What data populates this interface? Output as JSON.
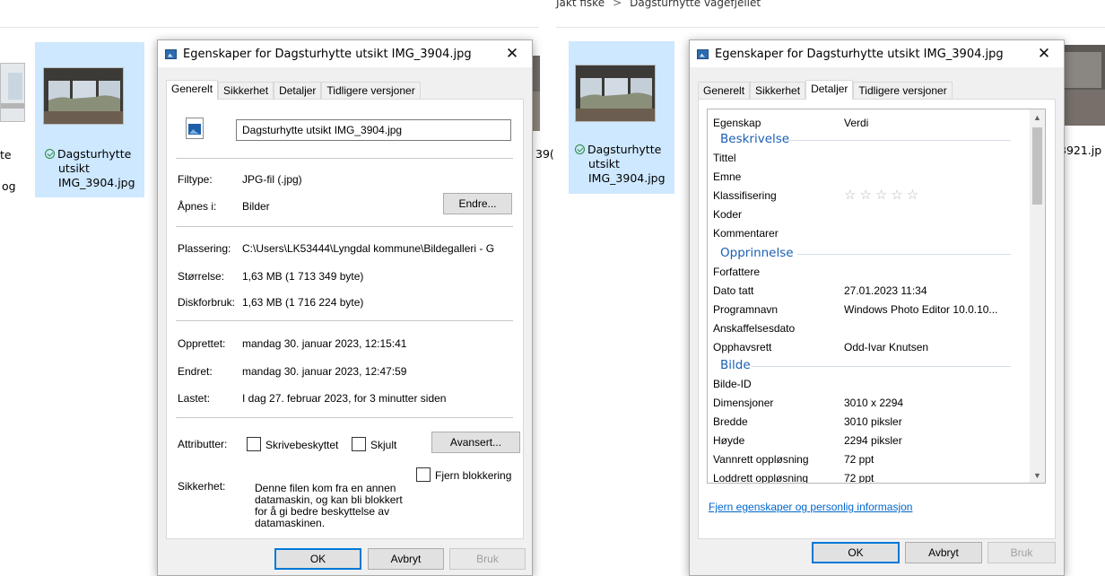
{
  "breadcrumb": {
    "part1": "Jakt fiske",
    "separator": ">",
    "part2": "Dagsturhytte vagefjellet"
  },
  "left_explorer": {
    "edge_left_lines": [
      "te",
      "og"
    ],
    "selected_item_lines": [
      "Dagsturhytte",
      "utsikt",
      "IMG_3904.jpg"
    ],
    "edge_right_text": "39("
  },
  "right_explorer": {
    "selected_item_lines": [
      "Dagsturhytte",
      "utsikt",
      "IMG_3904.jpg"
    ],
    "edge_right_text": "3921.jp"
  },
  "dialog_general": {
    "title": "Egenskaper for Dagsturhytte utsikt IMG_3904.jpg",
    "close": "✕",
    "tabs": [
      "Generelt",
      "Sikkerhet",
      "Detaljer",
      "Tidligere versjoner"
    ],
    "active_tab": "Generelt",
    "file_name": "Dagsturhytte utsikt IMG_3904.jpg",
    "filtype_label": "Filtype:",
    "filtype_value": "JPG-fil (.jpg)",
    "apnes_label": "Åpnes i:",
    "apnes_value": "Bilder",
    "change_button": "Endre...",
    "plassering_label": "Plassering:",
    "plassering_value": "C:\\Users\\LK53444\\Lyngdal kommune\\Bildegalleri - G",
    "storrelse_label": "Størrelse:",
    "storrelse_value": "1,63 MB (1 713 349 byte)",
    "disk_label": "Diskforbruk:",
    "disk_value": "1,63 MB (1 716 224 byte)",
    "opprettet_label": "Opprettet:",
    "opprettet_value": "mandag 30. januar 2023, 12:15:41",
    "endret_label": "Endret:",
    "endret_value": "mandag 30. januar 2023, 12:47:59",
    "lastet_label": "Lastet:",
    "lastet_value": "I dag 27. februar 2023, for 3 minutter siden",
    "attributter_label": "Attributter:",
    "skrivebeskyttet": "Skrivebeskyttet",
    "skjult": "Skjult",
    "avansert_button": "Avansert...",
    "sikkerhet_label": "Sikkerhet:",
    "sikkerhet_text_lines": [
      "Denne filen kom fra en annen",
      "datamaskin, og kan bli blokkert",
      "for å gi bedre beskyttelse av",
      "datamaskinen."
    ],
    "fjern_blokkering": "Fjern blokkering",
    "ok": "OK",
    "cancel": "Avbryt",
    "apply": "Bruk"
  },
  "dialog_details": {
    "title": "Egenskaper for Dagsturhytte utsikt IMG_3904.jpg",
    "close": "✕",
    "tabs": [
      "Generelt",
      "Sikkerhet",
      "Detaljer",
      "Tidligere versjoner"
    ],
    "active_tab": "Detaljer",
    "col_property": "Egenskap",
    "col_value": "Verdi",
    "groups": {
      "beskrivelse": "Beskrivelse",
      "opprinnelse": "Opprinnelse",
      "bilde": "Bilde"
    },
    "rows": {
      "tittel": "Tittel",
      "emne": "Emne",
      "klassifisering": "Klassifisering",
      "rating_stars": "☆☆☆☆☆",
      "rating_value": 0,
      "koder": "Koder",
      "kommentarer": "Kommentarer",
      "forfattere": "Forfattere",
      "dato_tatt": "Dato tatt",
      "dato_tatt_value": "27.01.2023 11:34",
      "programnavn": "Programnavn",
      "programnavn_value": "Windows Photo Editor 10.0.10...",
      "anskaffelsesdato": "Anskaffelsesdato",
      "opphavsrett": "Opphavsrett",
      "opphavsrett_value": "Odd-Ivar Knutsen",
      "bilde_id": "Bilde-ID",
      "dimensjoner": "Dimensjoner",
      "dimensjoner_value": "3010 x 2294",
      "bredde": "Bredde",
      "bredde_value": "3010 piksler",
      "hoyde": "Høyde",
      "hoyde_value": "2294 piksler",
      "vannrett": "Vannrett oppløsning",
      "vannrett_value": "72 ppt",
      "loddrett": "Loddrett oppløsning",
      "loddrett_value": "72 ppt"
    },
    "remove_link": "Fjern egenskaper og personlig informasjon",
    "ok": "OK",
    "cancel": "Avbryt",
    "apply": "Bruk"
  }
}
